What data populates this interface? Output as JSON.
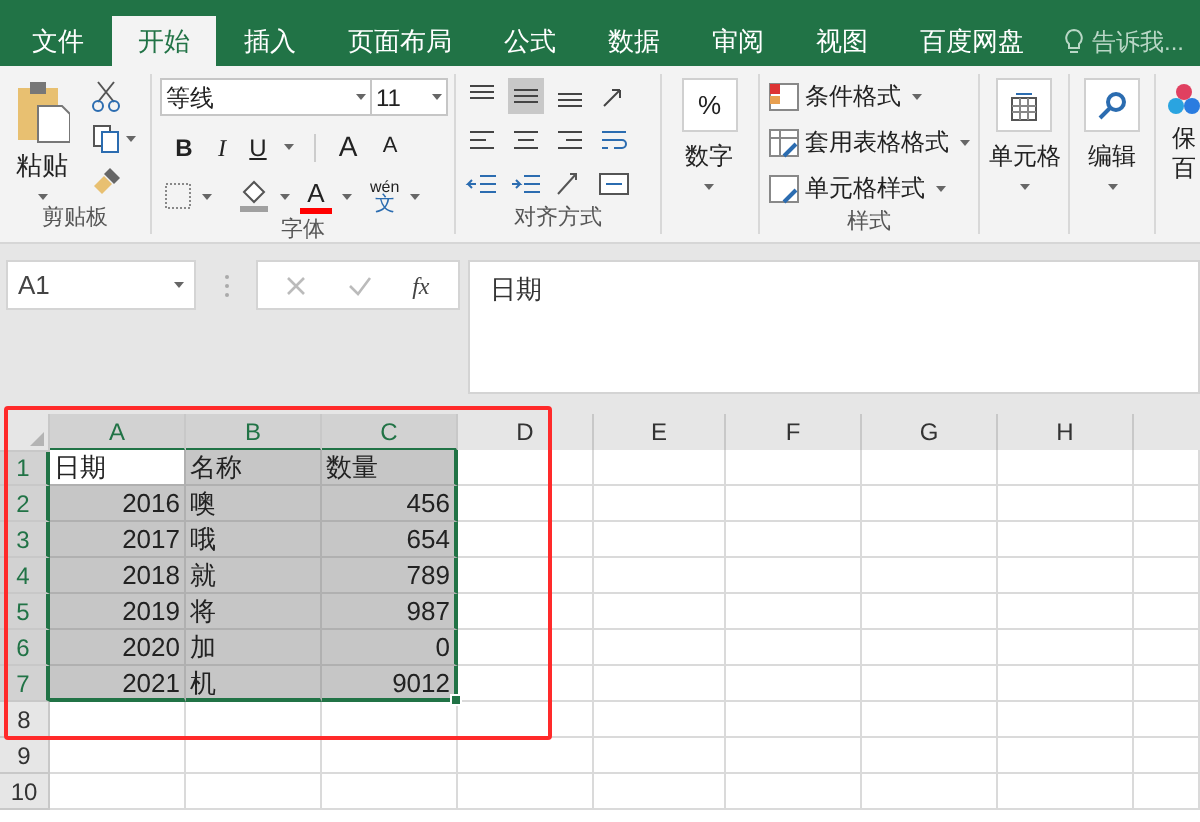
{
  "tabs": [
    {
      "label": "文件",
      "selected": false
    },
    {
      "label": "开始",
      "selected": true
    },
    {
      "label": "插入",
      "selected": false
    },
    {
      "label": "页面布局",
      "selected": false
    },
    {
      "label": "公式",
      "selected": false
    },
    {
      "label": "数据",
      "selected": false
    },
    {
      "label": "审阅",
      "selected": false
    },
    {
      "label": "视图",
      "selected": false
    },
    {
      "label": "百度网盘",
      "selected": false
    }
  ],
  "tell_me": {
    "placeholder": "告诉我..."
  },
  "clipboard": {
    "paste": "粘贴",
    "label": "剪贴板"
  },
  "font": {
    "name": "等线",
    "size": "11",
    "bold": "B",
    "italic": "I",
    "underline": "U",
    "grow": "A",
    "shrink": "A",
    "color_letter": "A",
    "phonetic_top": "wén",
    "phonetic_bottom": "文",
    "label": "字体"
  },
  "alignment": {
    "label": "对齐方式"
  },
  "number": {
    "symbol": "%",
    "label": "数字"
  },
  "styles": {
    "items": [
      "条件格式",
      "套用表格格式",
      "单元格样式"
    ],
    "label": "样式"
  },
  "cells": {
    "label": "单元格"
  },
  "editing": {
    "label": "编辑"
  },
  "save": {
    "line_1": "保",
    "line_2": "百"
  },
  "formula_bar": {
    "name_box": "A1",
    "function_label": "fx",
    "value": "日期"
  },
  "sheet": {
    "columns": [
      {
        "label": "A",
        "selected": true
      },
      {
        "label": "B",
        "selected": true
      },
      {
        "label": "C",
        "selected": true
      },
      {
        "label": "D",
        "selected": false
      },
      {
        "label": "E",
        "selected": false
      },
      {
        "label": "F",
        "selected": false
      },
      {
        "label": "G",
        "selected": false
      },
      {
        "label": "H",
        "selected": false
      }
    ],
    "rows": [
      {
        "label": "1",
        "selected": true,
        "cells": [
          {
            "text": "日期",
            "kind": "text",
            "highlighted": false
          },
          {
            "text": "名称",
            "kind": "text",
            "highlighted": true
          },
          {
            "text": "数量",
            "kind": "text",
            "highlighted": true
          }
        ]
      },
      {
        "label": "2",
        "selected": true,
        "cells": [
          {
            "text": "2016",
            "kind": "number",
            "highlighted": true
          },
          {
            "text": "噢",
            "kind": "text",
            "highlighted": true
          },
          {
            "text": "456",
            "kind": "number",
            "highlighted": true
          }
        ]
      },
      {
        "label": "3",
        "selected": true,
        "cells": [
          {
            "text": "2017",
            "kind": "number",
            "highlighted": true
          },
          {
            "text": "哦",
            "kind": "text",
            "highlighted": true
          },
          {
            "text": "654",
            "kind": "number",
            "highlighted": true
          }
        ]
      },
      {
        "label": "4",
        "selected": true,
        "cells": [
          {
            "text": "2018",
            "kind": "number",
            "highlighted": true
          },
          {
            "text": "就",
            "kind": "text",
            "highlighted": true
          },
          {
            "text": "789",
            "kind": "number",
            "highlighted": true
          }
        ]
      },
      {
        "label": "5",
        "selected": true,
        "cells": [
          {
            "text": "2019",
            "kind": "number",
            "highlighted": true
          },
          {
            "text": "将",
            "kind": "text",
            "highlighted": true
          },
          {
            "text": "987",
            "kind": "number",
            "highlighted": true
          }
        ]
      },
      {
        "label": "6",
        "selected": true,
        "cells": [
          {
            "text": "2020",
            "kind": "number",
            "highlighted": true
          },
          {
            "text": "加",
            "kind": "text",
            "highlighted": true
          },
          {
            "text": "0",
            "kind": "number",
            "highlighted": true
          }
        ]
      },
      {
        "label": "7",
        "selected": true,
        "cells": [
          {
            "text": "2021",
            "kind": "number",
            "highlighted": true
          },
          {
            "text": "机",
            "kind": "text",
            "highlighted": true
          },
          {
            "text": "9012",
            "kind": "number",
            "highlighted": true
          }
        ]
      },
      {
        "label": "8",
        "selected": false,
        "cells": []
      },
      {
        "label": "9",
        "selected": false,
        "cells": []
      },
      {
        "label": "10",
        "selected": false,
        "cells": []
      }
    ]
  }
}
